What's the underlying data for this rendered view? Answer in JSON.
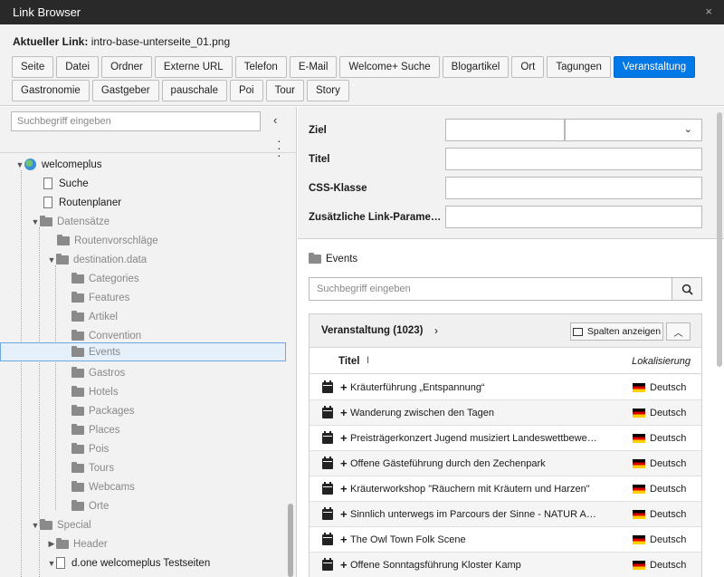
{
  "window": {
    "title": "Link Browser",
    "close": "×"
  },
  "current_link": {
    "label": "Aktueller Link:",
    "value": "intro-base-unterseite_01.png"
  },
  "tabs_row1": [
    "Seite",
    "Datei",
    "Ordner",
    "Externe URL",
    "Telefon",
    "E-Mail",
    "Welcome+ Suche",
    "Blogartikel",
    "Ort",
    "Tagungen",
    "Veranstaltung"
  ],
  "tabs_row2": [
    "Gastronomie",
    "Gastgeber",
    "pauschale",
    "Poi",
    "Tour",
    "Story"
  ],
  "active_tab": "Veranstaltung",
  "tree": {
    "search_placeholder": "Suchbegriff eingeben",
    "items": [
      {
        "label": "welcomeplus"
      },
      {
        "label": "Suche"
      },
      {
        "label": "Routenplaner"
      },
      {
        "label": "Datensätze"
      },
      {
        "label": "Routenvorschläge"
      },
      {
        "label": "destination.data"
      },
      {
        "label": "Categories"
      },
      {
        "label": "Features"
      },
      {
        "label": "Artikel"
      },
      {
        "label": "Convention"
      },
      {
        "label": "Events"
      },
      {
        "label": "Gastros"
      },
      {
        "label": "Hotels"
      },
      {
        "label": "Packages"
      },
      {
        "label": "Places"
      },
      {
        "label": "Pois"
      },
      {
        "label": "Tours"
      },
      {
        "label": "Webcams"
      },
      {
        "label": "Orte"
      },
      {
        "label": "Special"
      },
      {
        "label": "Header"
      },
      {
        "label": "d.one welcomeplus Testseiten"
      }
    ],
    "selected": "Events"
  },
  "form": {
    "ziel": "Ziel",
    "titel": "Titel",
    "css_klasse": "CSS-Klasse",
    "link_params": "Zusätzliche Link-Parame…"
  },
  "events_folder": "Events",
  "search_placeholder": "Suchbegriff eingeben",
  "table": {
    "title": "Veranstaltung (1023)",
    "columns_button": "Spalten anzeigen",
    "col_title": "Titel",
    "col_locale": "Lokalisierung",
    "rows": [
      {
        "title": "Kräuterführung „Entspannung“",
        "lang": "Deutsch"
      },
      {
        "title": "Wanderung zwischen den Tagen",
        "lang": "Deutsch"
      },
      {
        "title": "Preisträgerkonzert Jugend musiziert Landeswettbewe…",
        "lang": "Deutsch"
      },
      {
        "title": "Offene Gästeführung durch den Zechenpark",
        "lang": "Deutsch"
      },
      {
        "title": "Kräuterworkshop \"Räuchern mit Kräutern und Harzen\"",
        "lang": "Deutsch"
      },
      {
        "title": "Sinnlich unterwegs im Parcours der Sinne - NATUR A…",
        "lang": "Deutsch"
      },
      {
        "title": "The Owl Town Folk Scene",
        "lang": "Deutsch"
      },
      {
        "title": "Offene Sonntagsführung Kloster Kamp",
        "lang": "Deutsch"
      }
    ]
  },
  "colors": {
    "titlebar": "#292929",
    "active_tab": "#0078e6",
    "selection": "#e6f0fb"
  }
}
